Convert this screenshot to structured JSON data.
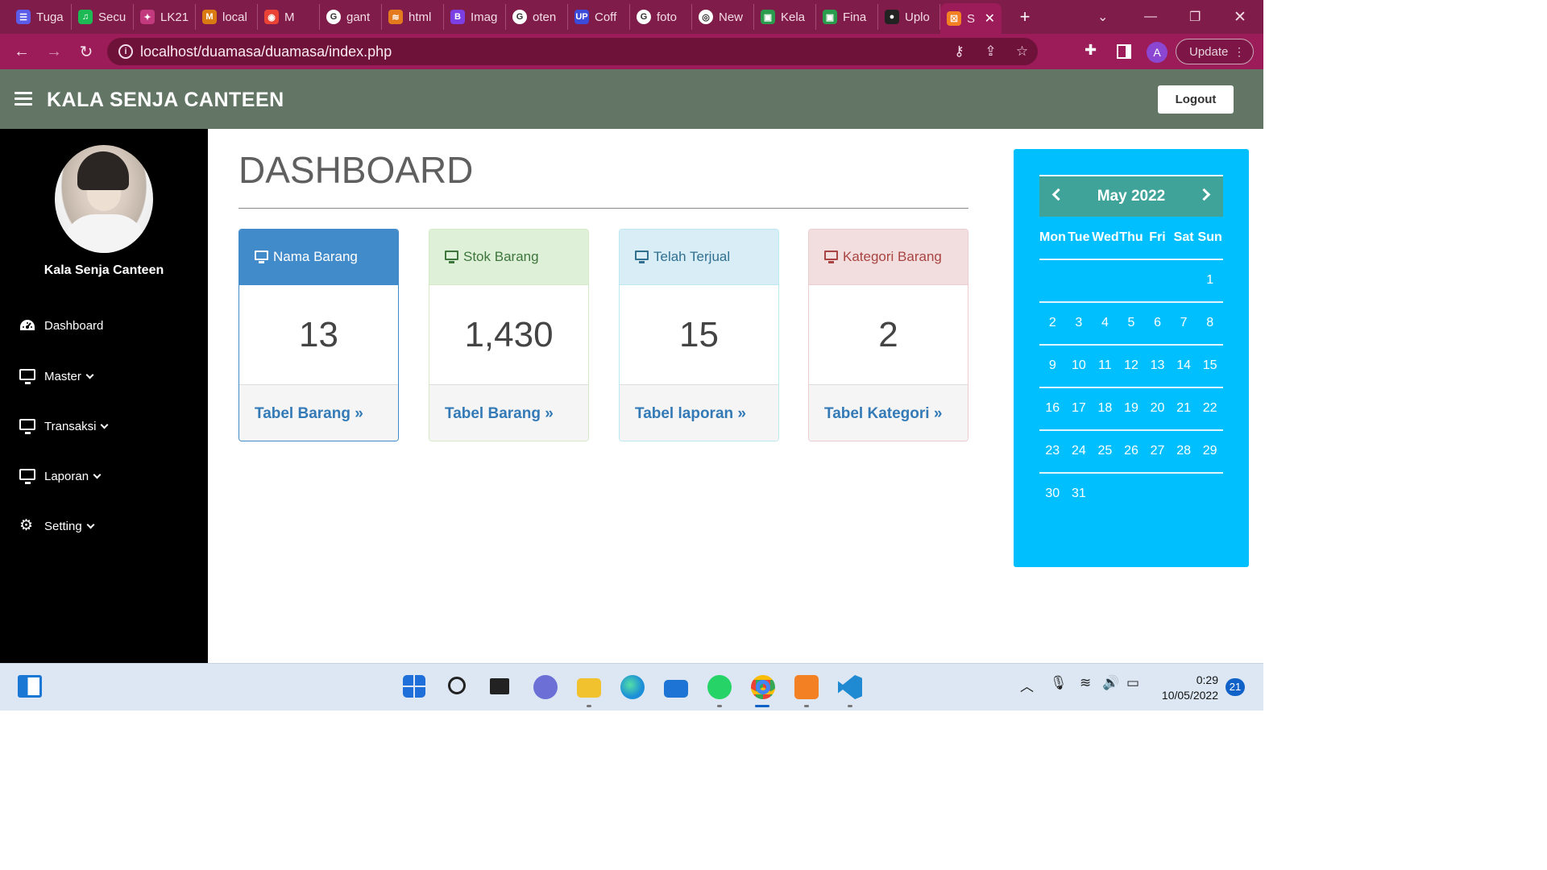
{
  "browser": {
    "tabs": [
      {
        "label": "Tuga",
        "color": "#5c5ce8",
        "glyph": "☰"
      },
      {
        "label": "Secu",
        "color": "#1db954",
        "glyph": "♫"
      },
      {
        "label": "LK21",
        "color": "#c23a7d",
        "glyph": "✦"
      },
      {
        "label": "local",
        "color": "#d97b12",
        "glyph": "M"
      },
      {
        "label": "M",
        "color": "#ea4335",
        "glyph": "◉"
      },
      {
        "label": "gant",
        "color": "#ffffff",
        "glyph": "G"
      },
      {
        "label": "html",
        "color": "#e37b1e",
        "glyph": "≋"
      },
      {
        "label": "Imag",
        "color": "#7b3fe4",
        "glyph": "B"
      },
      {
        "label": "oten",
        "color": "#ffffff",
        "glyph": "G"
      },
      {
        "label": "Coff",
        "color": "#3b4ad9",
        "glyph": "UP"
      },
      {
        "label": "foto",
        "color": "#ffffff",
        "glyph": "G"
      },
      {
        "label": "New",
        "color": "#ffffff",
        "glyph": "◎"
      },
      {
        "label": "Kela",
        "color": "#2b9b4d",
        "glyph": "▣"
      },
      {
        "label": "Fina",
        "color": "#2b9b4d",
        "glyph": "▣"
      },
      {
        "label": "Uplo",
        "color": "#222222",
        "glyph": "●"
      }
    ],
    "active_tab": {
      "label": "S",
      "glyph": "☒",
      "color": "#f48024"
    },
    "new_tab": "+",
    "url": "localhost/duamasa/duamasa/index.php",
    "update_label": "Update",
    "profile_initial": "A"
  },
  "app": {
    "title": "KALA SENJA CANTEEN",
    "logout": "Logout",
    "username": "Kala Senja Canteen",
    "nav": [
      {
        "label": "Dashboard",
        "icon": "dashboard-icon",
        "chevron": false
      },
      {
        "label": "Master",
        "icon": "monitor-icon",
        "chevron": true
      },
      {
        "label": "Transaksi",
        "icon": "monitor-icon",
        "chevron": true
      },
      {
        "label": "Laporan",
        "icon": "monitor-icon",
        "chevron": true
      },
      {
        "label": "Setting",
        "icon": "gear-icon",
        "chevron": true
      }
    ],
    "page_title": "DASHBOARD",
    "cards": [
      {
        "title": "Nama Barang",
        "value": "13",
        "link": "Tabel Barang »",
        "head_bg": "#428bca",
        "head_fg": "#ffffff",
        "border": "#428bca"
      },
      {
        "title": "Stok Barang",
        "value": "1,430",
        "link": "Tabel Barang »",
        "head_bg": "#dff0d8",
        "head_fg": "#3c763d",
        "border": "#d6e9c6"
      },
      {
        "title": "Telah Terjual",
        "value": "15",
        "link": "Tabel laporan »",
        "head_bg": "#d9edf7",
        "head_fg": "#31708f",
        "border": "#bce8f1"
      },
      {
        "title": "Kategori Barang",
        "value": "2",
        "link": "Tabel Kategori »",
        "head_bg": "#f2dede",
        "head_fg": "#a94442",
        "border": "#ebccd1"
      }
    ],
    "calendar": {
      "month": "May 2022",
      "weekdays": [
        "Mon",
        "Tue",
        "Wed",
        "Thu",
        "Fri",
        "Sat",
        "Sun"
      ],
      "weeks": [
        [
          "",
          "",
          "",
          "",
          "",
          "",
          "1"
        ],
        [
          "2",
          "3",
          "4",
          "5",
          "6",
          "7",
          "8"
        ],
        [
          "9",
          "10",
          "11",
          "12",
          "13",
          "14",
          "15"
        ],
        [
          "16",
          "17",
          "18",
          "19",
          "20",
          "21",
          "22"
        ],
        [
          "23",
          "24",
          "25",
          "26",
          "27",
          "28",
          "29"
        ],
        [
          "30",
          "31",
          "",
          "",
          "",
          "",
          ""
        ]
      ]
    }
  },
  "taskbar": {
    "time": "0:29",
    "date": "10/05/2022",
    "notifications": "21"
  }
}
